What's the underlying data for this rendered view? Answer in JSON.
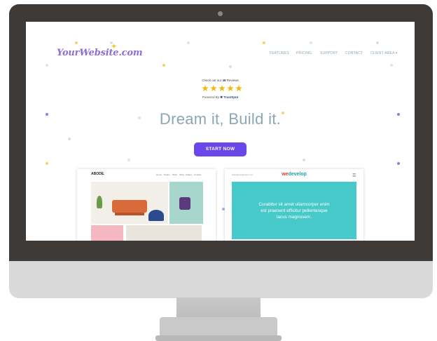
{
  "site": {
    "logo": "YourWebsite.com",
    "nav": [
      "FEATURES",
      "PRICING",
      "SUPPORT",
      "CONTACT",
      "CLIENT AREA ▾"
    ]
  },
  "reviews": {
    "prefix": "Check out our",
    "count": "48",
    "suffix": "Reviews",
    "rating": 5,
    "powered_by": "Powered By",
    "brand": "TrustSpot"
  },
  "hero": {
    "headline": "Dream it, Build it.",
    "cta_label": "START NOW"
  },
  "preview_left": {
    "logo": "ABODE.",
    "nav": [
      "Home",
      "Studio",
      "Work",
      "Shop",
      "Gallery",
      "Contact"
    ]
  },
  "preview_right": {
    "logo_prefix": "we",
    "logo_suffix": "develop",
    "top_text": "hello@wedevelop.com",
    "menu_icon": "☰",
    "hero_text": "Curabitur sit amet ullamcorper enim est praesent efficitur pellentesque lacus magnusem."
  },
  "colors": {
    "accent": "#6a47e8",
    "logo": "#8a6fd6",
    "muted_text": "#8aa7b5",
    "star": "#f2b705",
    "teal": "#46c9c8"
  }
}
